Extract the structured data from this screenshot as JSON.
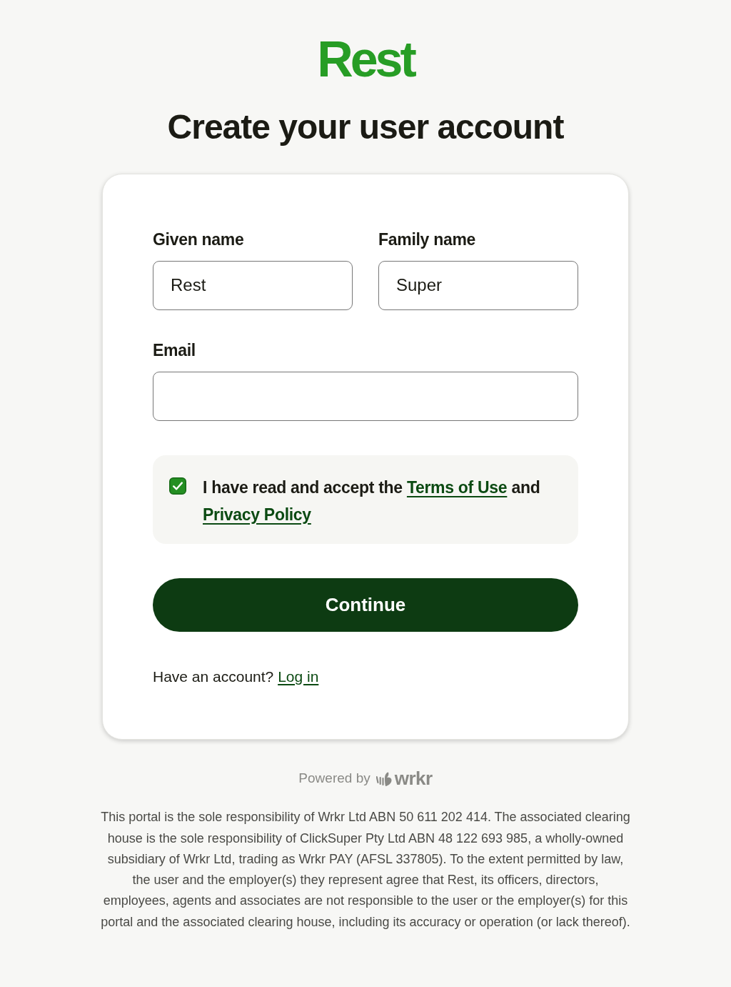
{
  "logo": {
    "text": "Rest"
  },
  "title": "Create your user account",
  "form": {
    "name_fields": [
      {
        "label": "Given name",
        "value": "Rest"
      },
      {
        "label": "Family name",
        "value": "Super"
      }
    ],
    "email": {
      "label": "Email"
    },
    "consent": {
      "checked": true,
      "parts": [
        {
          "kind": "text",
          "text": "I have read and accept the"
        },
        {
          "kind": "link",
          "text": "Terms of Use"
        },
        {
          "kind": "text",
          "text": "and"
        },
        {
          "kind": "link",
          "text": "Privacy Policy"
        }
      ]
    },
    "submit": {
      "label": "Continue"
    },
    "login_prompt": {
      "text": "Have an account?",
      "link": "Log in"
    }
  },
  "footer": {
    "powered_by": "Powered by",
    "brand": "wrkr",
    "disclaimer": "This portal is the sole responsibility of Wrkr Ltd ABN 50 611 202 414. The associated clearing house is the sole responsibility of ClickSuper Pty Ltd ABN 48 122 693 985, a wholly-owned subsidiary of Wrkr Ltd, trading as Wrkr PAY (AFSL 337805). To the extent permitted by law, the user and the employer(s) they represent agree that Rest, its officers, directors, employees, agents and associates are not responsible to the user or the employer(s) for this portal and the associated clearing house, including its accuracy or operation (or lack thereof)."
  }
}
